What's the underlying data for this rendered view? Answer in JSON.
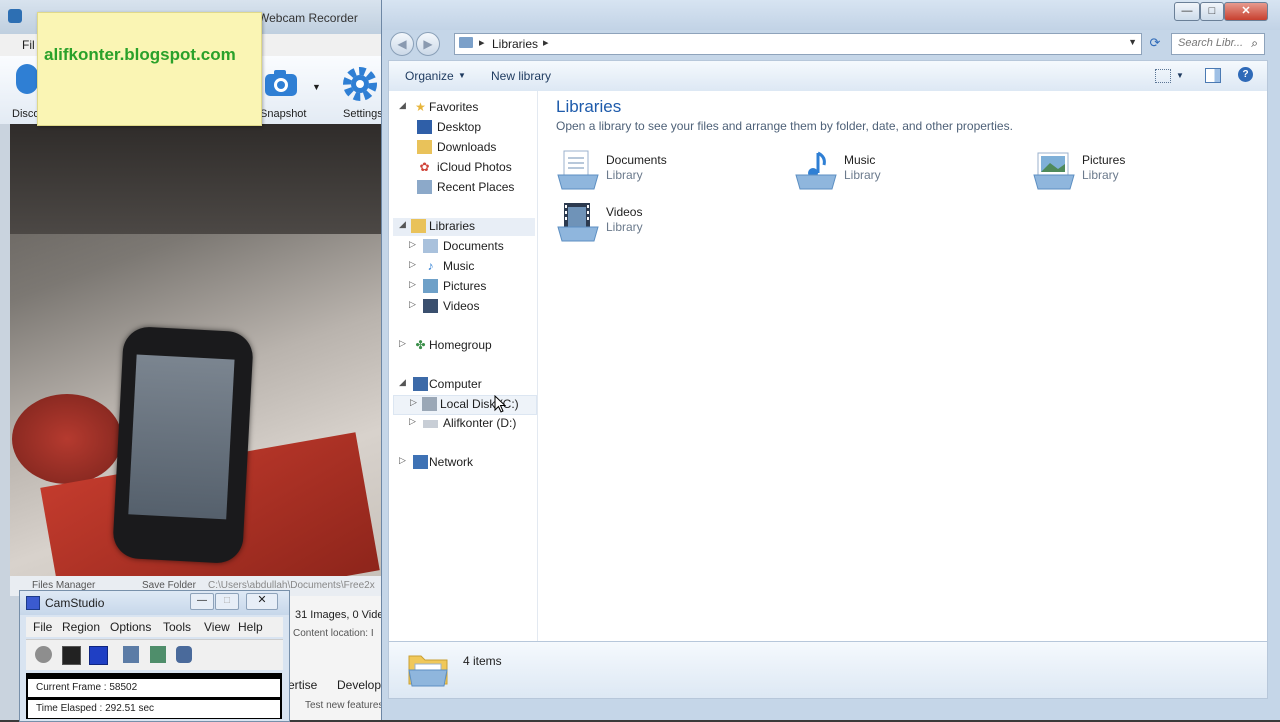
{
  "webcam": {
    "title": "Webcam Recorder",
    "menu_file": "Fil",
    "toolbar": {
      "discover": "Disco",
      "snapshot": "Snapshot",
      "settings": "Settings"
    },
    "status": {
      "files_manager": "Files Manager",
      "save_folder": "Save Folder",
      "save_path": "C:\\Users\\abdullah\\Documents\\Free2x"
    },
    "info": {
      "images_line": "31 Images, 0 Vide",
      "content_location": "Content location: I"
    },
    "bottom": {
      "advertise": "ertise",
      "develop": "Develop",
      "test_new": "Test new features"
    }
  },
  "sticky_note": {
    "text": "alifkonter.blogspot.com",
    "color": "#2aa12a"
  },
  "camstudio": {
    "title": "CamStudio",
    "menu": [
      "File",
      "Region",
      "Options",
      "Tools",
      "View",
      "Help"
    ],
    "current_frame": "Current Frame : 58502",
    "time_elapsed": "Time Elasped : 292.51 sec"
  },
  "explorer": {
    "breadcrumb": "Libraries",
    "search_placeholder": "Search Libr...",
    "commands": {
      "organize": "Organize",
      "new_library": "New library"
    },
    "nav": {
      "favorites": "Favorites",
      "favorites_items": [
        "Desktop",
        "Downloads",
        "iCloud Photos",
        "Recent Places"
      ],
      "libraries": "Libraries",
      "libraries_items": [
        "Documents",
        "Music",
        "Pictures",
        "Videos"
      ],
      "homegroup": "Homegroup",
      "computer": "Computer",
      "computer_items": [
        "Local Disk (C:)",
        "Alifkonter (D:)"
      ],
      "network": "Network"
    },
    "content": {
      "heading": "Libraries",
      "subheading": "Open a library to see your files and arrange them by folder, date, and other properties.",
      "items": [
        {
          "name": "Documents",
          "type": "Library"
        },
        {
          "name": "Music",
          "type": "Library"
        },
        {
          "name": "Pictures",
          "type": "Library"
        },
        {
          "name": "Videos",
          "type": "Library"
        }
      ]
    },
    "status": "4 items",
    "accent": "#1e5bab"
  }
}
